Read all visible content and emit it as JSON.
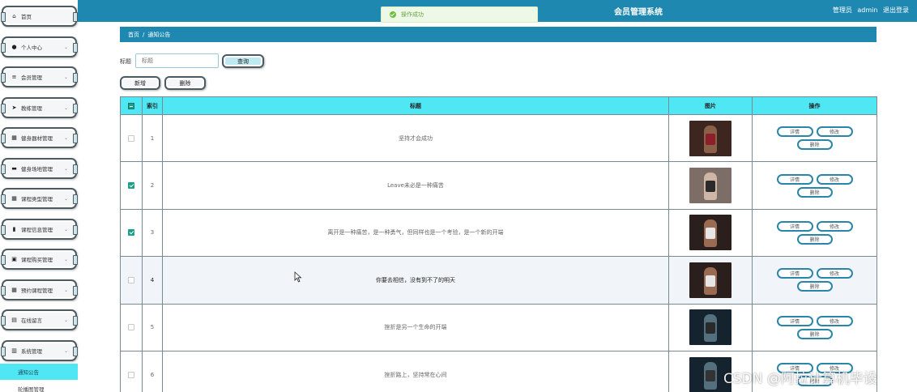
{
  "header": {
    "system_title": "会员管理系统",
    "role": "管理员",
    "username": "admin",
    "logout": "退出登录",
    "toast": "操作成功"
  },
  "sidebar": {
    "items": [
      {
        "label": "首页",
        "icon": "home-icon",
        "glyph": "⌂",
        "chevron": false
      },
      {
        "label": "个人中心",
        "icon": "user-icon",
        "glyph": "●",
        "chevron": true
      },
      {
        "label": "会员管理",
        "icon": "list-icon",
        "glyph": "≡",
        "chevron": true
      },
      {
        "label": "教练管理",
        "icon": "send-icon",
        "glyph": "➤",
        "chevron": true
      },
      {
        "label": "健身器材管理",
        "icon": "grid-icon",
        "glyph": "▦",
        "chevron": true
      },
      {
        "label": "健身场地管理",
        "icon": "monitor-icon",
        "glyph": "▬",
        "chevron": true
      },
      {
        "label": "课程类型管理",
        "icon": "grid-icon",
        "glyph": "▦",
        "chevron": true
      },
      {
        "label": "课程信息管理",
        "icon": "bar-chart-icon",
        "glyph": "▮",
        "chevron": true
      },
      {
        "label": "课程购买管理",
        "icon": "briefcase-icon",
        "glyph": "▣",
        "chevron": true
      },
      {
        "label": "预约课程管理",
        "icon": "grid-icon",
        "glyph": "▦",
        "chevron": true
      },
      {
        "label": "在线留言",
        "icon": "document-icon",
        "glyph": "▤",
        "chevron": true
      },
      {
        "label": "系统管理",
        "icon": "clipboard-icon",
        "glyph": "▥",
        "chevron": true
      }
    ],
    "sub_items": [
      "通知公告",
      "轮播图管理"
    ]
  },
  "breadcrumb": {
    "home": "首页",
    "separator": "/",
    "current": "通知公告"
  },
  "search": {
    "label": "标题",
    "placeholder": "标题",
    "button": "查询"
  },
  "actions": {
    "add": "新增",
    "delete": "删除"
  },
  "table": {
    "headers": [
      "索引",
      "标题",
      "图片",
      "操作"
    ],
    "row_buttons": {
      "detail": "详情",
      "edit": "修改",
      "remove": "删除"
    },
    "rows": [
      {
        "index": "1",
        "title": "坚持才会成功",
        "checked": false,
        "thumb": [
          "#3e2620",
          "#8b6048",
          "#8d1f2a"
        ]
      },
      {
        "index": "2",
        "title": "Leave未必是一种痛苦",
        "checked": true,
        "thumb": [
          "#7c6e66",
          "#cfb5a6",
          "#2a2a2a"
        ]
      },
      {
        "index": "3",
        "title": "离开是一种痛苦，是一种勇气，但同样也是一个考验，是一个新的开端",
        "checked": true,
        "thumb": [
          "#2b1f1d",
          "#9b6a52",
          "#e6e6e6"
        ]
      },
      {
        "index": "4",
        "title": "你要去相信，没有到不了的明天",
        "checked": false,
        "thumb": [
          "#2b1f1d",
          "#9b6a52",
          "#e6e6e6"
        ]
      },
      {
        "index": "5",
        "title": "挫折是另一个生命的开端",
        "checked": false,
        "thumb": [
          "#14232d",
          "#54707e",
          "#2a2a2a"
        ]
      },
      {
        "index": "6",
        "title": "挫折路上，坚持常在心间",
        "checked": false,
        "thumb": [
          "#14232d",
          "#54707e",
          "#333333"
        ]
      }
    ]
  },
  "watermark": "CSDN @阿拉计算机毕设",
  "colors": {
    "header": "#1e88b0",
    "table_header": "#4ee7f3",
    "checkbox": "#1aa088"
  }
}
